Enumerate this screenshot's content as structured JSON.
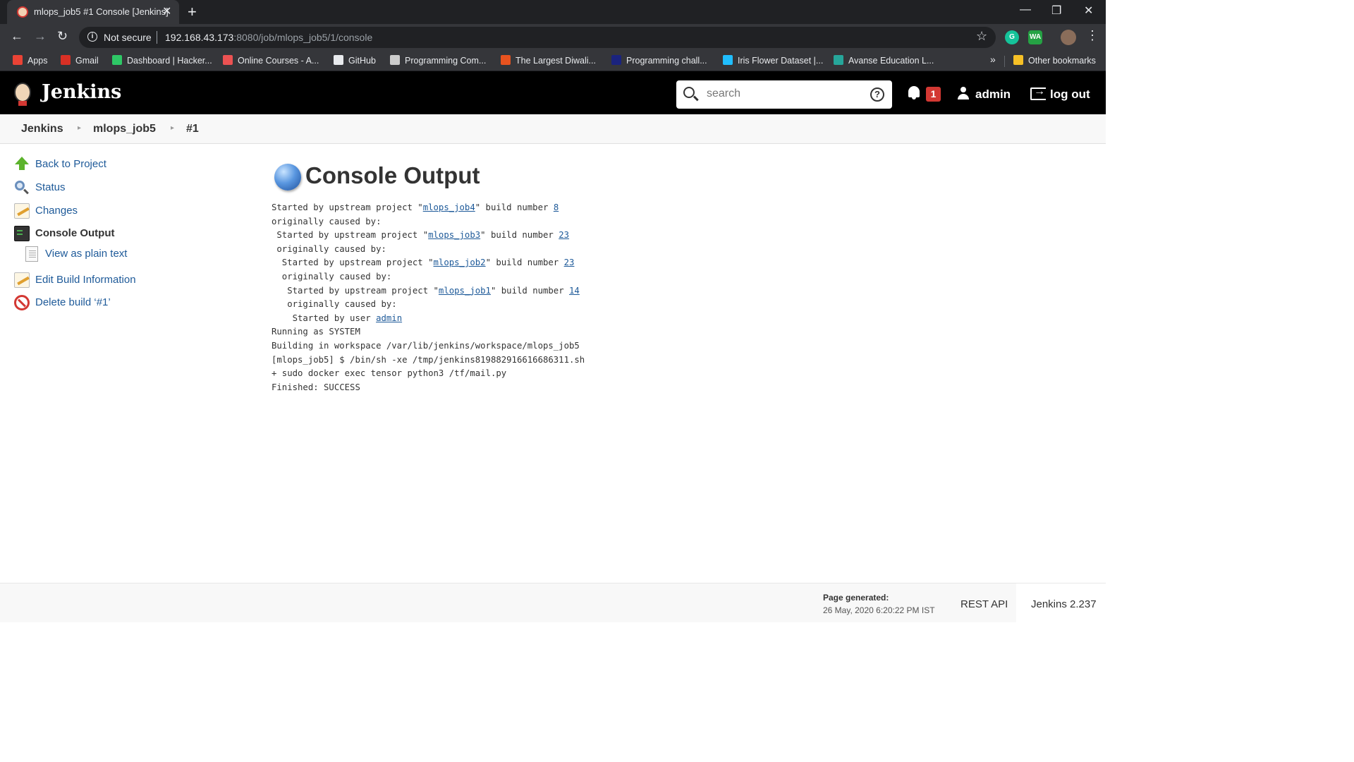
{
  "browser": {
    "tab_title": "mlops_job5 #1 Console [Jenkins]",
    "security_label": "Not secure",
    "url_host": "192.168.43.173",
    "url_rest": ":8080/job/mlops_job5/1/console",
    "bookmarks": [
      {
        "label": "Apps",
        "color": "#ea4335"
      },
      {
        "label": "Gmail",
        "color": "#d93025"
      },
      {
        "label": "Dashboard | Hacker...",
        "color": "#2ec866"
      },
      {
        "label": "Online Courses - A...",
        "color": "#ec5252"
      },
      {
        "label": "GitHub",
        "color": "#e8eaed"
      },
      {
        "label": "Programming Com...",
        "color": "#cccccc"
      },
      {
        "label": "The Largest Diwali...",
        "color": "#e8531f"
      },
      {
        "label": "Programming chall...",
        "color": "#1a237e"
      },
      {
        "label": "Iris Flower Dataset |...",
        "color": "#20beff"
      },
      {
        "label": "Avanse Education L...",
        "color": "#26a69a"
      }
    ],
    "other_bookmarks": "Other bookmarks"
  },
  "header": {
    "brand": "Jenkins",
    "search_placeholder": "search",
    "notification_count": "1",
    "user": "admin",
    "logout": "log out"
  },
  "breadcrumb": [
    "Jenkins",
    "mlops_job5",
    "#1"
  ],
  "sidebar": [
    {
      "label": "Back to Project",
      "icon": "up-arrow-icon"
    },
    {
      "label": "Status",
      "icon": "magnifier-icon"
    },
    {
      "label": "Changes",
      "icon": "notepad-icon"
    },
    {
      "label": "Console Output",
      "icon": "terminal-icon"
    },
    {
      "label": "View as plain text",
      "icon": "document-icon"
    },
    {
      "label": "Edit Build Information",
      "icon": "notepad-icon"
    },
    {
      "label": "Delete build ‘#1’",
      "icon": "no-entry-icon"
    }
  ],
  "main": {
    "title": "Console Output",
    "lines": [
      {
        "pre": "Started by upstream project \"",
        "link": "mlops_job4",
        "mid": "\" build number ",
        "link2": "8",
        "post": ""
      },
      {
        "pre": "originally caused by:"
      },
      {
        "pre": " Started by upstream project \"",
        "link": "mlops_job3",
        "mid": "\" build number ",
        "link2": "23",
        "post": ""
      },
      {
        "pre": " originally caused by:"
      },
      {
        "pre": "  Started by upstream project \"",
        "link": "mlops_job2",
        "mid": "\" build number ",
        "link2": "23",
        "post": ""
      },
      {
        "pre": "  originally caused by:"
      },
      {
        "pre": "   Started by upstream project \"",
        "link": "mlops_job1",
        "mid": "\" build number ",
        "link2": "14",
        "post": ""
      },
      {
        "pre": "   originally caused by:"
      },
      {
        "pre": "    Started by user ",
        "link": "admin"
      },
      {
        "pre": "Running as SYSTEM"
      },
      {
        "pre": "Building in workspace /var/lib/jenkins/workspace/mlops_job5"
      },
      {
        "pre": "[mlops_job5] $ /bin/sh -xe /tmp/jenkins819882916616686311.sh"
      },
      {
        "pre": "+ sudo docker exec tensor python3 /tf/mail.py"
      },
      {
        "pre": "Finished: SUCCESS"
      }
    ]
  },
  "footer": {
    "page_generated_label": "Page generated:",
    "page_generated_date": "26 May, 2020 6:20:22 PM IST",
    "rest_api": "REST API",
    "version": "Jenkins 2.237"
  },
  "colors": {
    "header_bg": "#000000",
    "link": "#1e5a99",
    "badge": "#d33833"
  }
}
